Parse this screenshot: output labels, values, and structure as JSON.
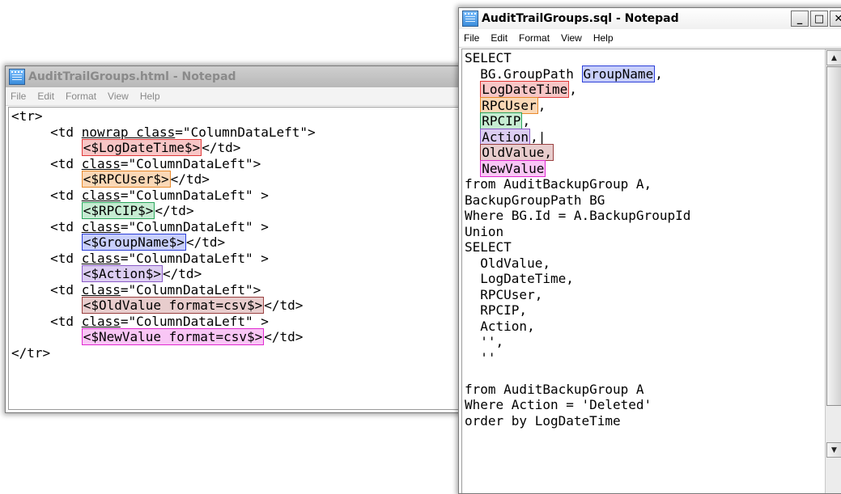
{
  "html_window": {
    "title": "AuditTrailGroups.html - Notepad",
    "menu": [
      "File",
      "Edit",
      "Format",
      "View",
      "Help"
    ],
    "lines": {
      "l1": "<tr>",
      "l2_pre": "     <td ",
      "l2_u": "nowrap class",
      "l2_post": "=\"ColumnDataLeft\">",
      "l3_pre": "         ",
      "l3_hl": "<$LogDateTime$>",
      "l3_post": "</td>",
      "l4_pre": "     <td ",
      "l4_u": "class",
      "l4_post": "=\"ColumnDataLeft\">",
      "l5_pre": "         ",
      "l5_hl": "<$RPCUser$>",
      "l5_post": "</td>",
      "l6_pre": "     <td ",
      "l6_u": "class",
      "l6_post": "=\"ColumnDataLeft\" >",
      "l7_pre": "         ",
      "l7_hl": "<$RPCIP$>",
      "l7_post": "</td>",
      "l8_pre": "     <td ",
      "l8_u": "class",
      "l8_post": "=\"ColumnDataLeft\" >",
      "l9_pre": "         ",
      "l9_hl": "<$GroupName$>",
      "l9_post": "</td>",
      "l10_pre": "     <td ",
      "l10_u": "class",
      "l10_post": "=\"ColumnDataLeft\" >",
      "l11_pre": "         ",
      "l11_hl": "<$Action$>",
      "l11_post": "</td>",
      "l12_pre": "     <td ",
      "l12_u": "class",
      "l12_post": "=\"ColumnDataLeft\">",
      "l13_pre": "         ",
      "l13_hl": "<$OldValue format=csv$>",
      "l13_post": "</td>",
      "l14_pre": "     <td ",
      "l14_u": "class",
      "l14_post": "=\"ColumnDataLeft\" >",
      "l15_pre": "         ",
      "l15_hl": "<$NewValue format=csv$>",
      "l15_post": "</td>",
      "l16": "</tr>"
    }
  },
  "sql_window": {
    "title": "AuditTrailGroups.sql - Notepad",
    "menu": [
      "File",
      "Edit",
      "Format",
      "View",
      "Help"
    ],
    "controls": {
      "minimize": "_",
      "maximize": "□",
      "close": "✕"
    },
    "lines": {
      "s1": "SELECT",
      "s2_pre": "  BG.GroupPath ",
      "s2_hl": "GroupName",
      "s2_post": ",",
      "s3_pre": "  ",
      "s3_hl": "LogDateTime",
      "s3_post": ",",
      "s4_pre": "  ",
      "s4_hl": "RPCUser",
      "s4_post": ",",
      "s5_pre": "  ",
      "s5_hl": "RPCIP",
      "s5_post": ",",
      "s6_pre": "  ",
      "s6_hl": "Action",
      "s6_post": ",|",
      "s7_pre": "  ",
      "s7_hl": "OldValue,",
      "s8_pre": "  ",
      "s8_hl": "NewValue",
      "s9": "from AuditBackupGroup A,",
      "s10": "BackupGroupPath BG",
      "s11": "Where BG.Id = A.BackupGroupId",
      "s12": "Union",
      "s13": "SELECT",
      "s14": "  OldValue,",
      "s15": "  LogDateTime,",
      "s16": "  RPCUser,",
      "s17": "  RPCIP,",
      "s18": "  Action,",
      "s19": "  '',",
      "s20": "  ''",
      "s21": "",
      "s22": "from AuditBackupGroup A",
      "s23": "Where Action = 'Deleted'",
      "s24": "order by LogDateTime"
    }
  }
}
